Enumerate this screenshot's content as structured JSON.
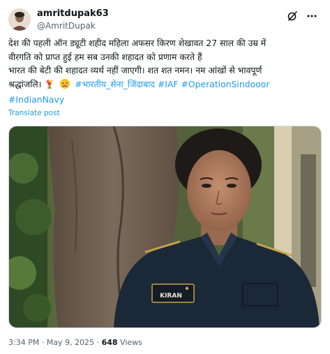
{
  "author": {
    "display_name": "amritdupak63",
    "handle": "@AmritDupak"
  },
  "header_icons": [
    "grok-icon",
    "more-icon"
  ],
  "tweet": {
    "line1": "देश की पहली ऑन ड्यूटी शहीद महिला अफसर किरण शेखावत 27 साल की उम्र में",
    "line2": "वीरगति को प्राप्त हुई हम सब उनकी शहादत को प्रणाम करते हैं",
    "line3": "भारत की बेटी की शहादत व्यर्थ नहीं जाएगी। शत शत नमन। नम आंखों से भावपूर्ण",
    "line4_text": "श्रद्धांजलि।",
    "emojis": [
      "bouquet-emoji",
      "sad-face-emoji"
    ],
    "hashtags_line4": "#भारतीय_सेना_जिंदाबाद #IAF #OperationSindooor",
    "hashtags_line5": "#IndianNavy"
  },
  "translate_label": "Translate post",
  "media": {
    "name_tag": "KIRAN",
    "colors": {
      "uniform": "#1b2838",
      "trunk": "#6b5a4c",
      "foliage": "#3a5a2a",
      "gold": "#c8a24a"
    }
  },
  "meta": {
    "time": "3:34 PM",
    "separator": "·",
    "date": "May 9, 2025",
    "views_count": "648",
    "views_label": "Views"
  }
}
